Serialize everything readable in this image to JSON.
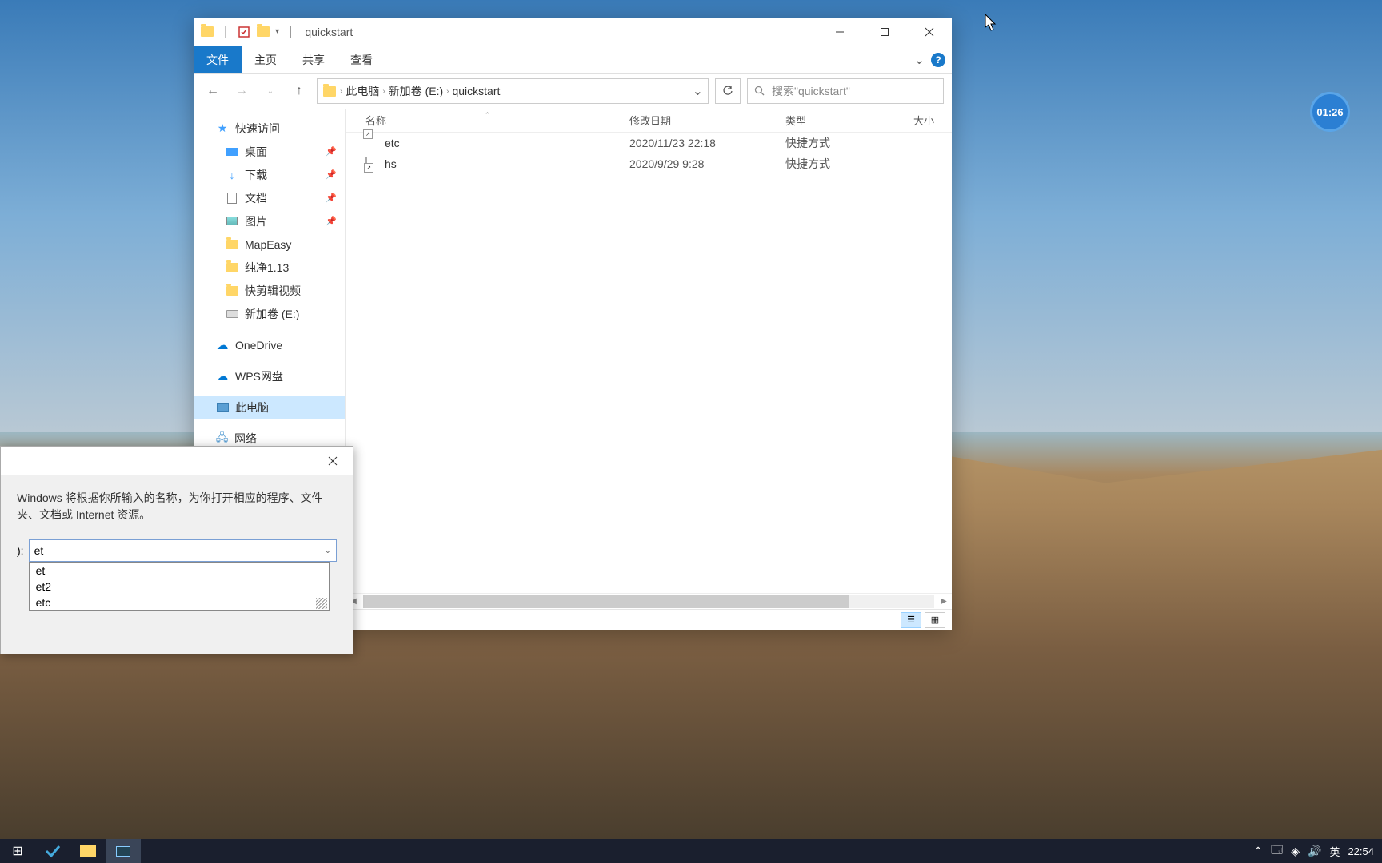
{
  "window": {
    "title": "quickstart",
    "tabs": {
      "file": "文件",
      "home": "主页",
      "share": "共享",
      "view": "查看"
    }
  },
  "breadcrumb": [
    "此电脑",
    "新加卷 (E:)",
    "quickstart"
  ],
  "search": {
    "placeholder": "搜索\"quickstart\""
  },
  "columns": {
    "name": "名称",
    "date": "修改日期",
    "type": "类型",
    "size": "大小"
  },
  "files": [
    {
      "name": "etc",
      "date": "2020/11/23 22:18",
      "type": "快捷方式",
      "icon": "folder"
    },
    {
      "name": "hs",
      "date": "2020/9/29 9:28",
      "type": "快捷方式",
      "icon": "file"
    }
  ],
  "navpane": {
    "quickaccess": "快速访问",
    "desktop": "桌面",
    "downloads": "下载",
    "documents": "文档",
    "pictures": "图片",
    "mapeasy": "MapEasy",
    "chunjing": "纯净1.13",
    "kuaijian": "快剪辑视频",
    "drive_e": "新加卷 (E:)",
    "onedrive": "OneDrive",
    "wps": "WPS网盘",
    "thispc": "此电脑",
    "network": "网络"
  },
  "run": {
    "desc": "Windows 将根据你所输入的名称，为你打开相应的程序、文件夹、文档或 Internet 资源。",
    "label": "):",
    "value": "et",
    "options": [
      "et",
      "et2",
      "etc"
    ]
  },
  "tray": {
    "ime": "英",
    "time": "22:54"
  },
  "clock_widget": "01:26"
}
